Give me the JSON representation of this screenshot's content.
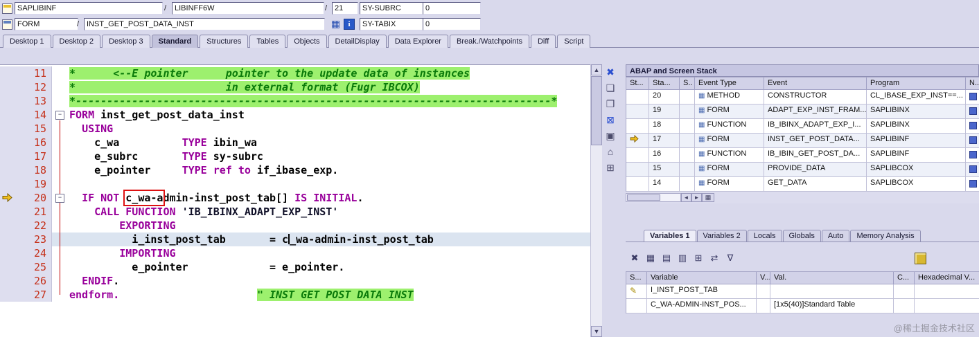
{
  "header": {
    "separator": "/",
    "program_field": "SAPLIBINF",
    "include_field": "LIBINFF6W",
    "line_field": "21",
    "sy_subrc_label": "SY-SUBRC",
    "sy_subrc_value": "0",
    "event_type_field": "FORM",
    "event_name_field": "INST_GET_POST_DATA_INST",
    "sy_tabix_label": "SY-TABIX",
    "sy_tabix_value": "0"
  },
  "tabs": [
    {
      "label": "Desktop 1",
      "active": false
    },
    {
      "label": "Desktop 2",
      "active": false
    },
    {
      "label": "Desktop 3",
      "active": false
    },
    {
      "label": "Standard",
      "active": true
    },
    {
      "label": "Structures",
      "active": false
    },
    {
      "label": "Tables",
      "active": false
    },
    {
      "label": "Objects",
      "active": false
    },
    {
      "label": "DetailDisplay",
      "active": false
    },
    {
      "label": "Data Explorer",
      "active": false
    },
    {
      "label": "Break./Watchpoints",
      "active": false
    },
    {
      "label": "Diff",
      "active": false
    },
    {
      "label": "Script",
      "active": false
    }
  ],
  "editor": {
    "lines": [
      {
        "num": "11",
        "segs": [
          {
            "t": "*      <--E pointer      pointer to the update data of instances",
            "c": "cmt"
          }
        ]
      },
      {
        "num": "12",
        "segs": [
          {
            "t": "*                        in external format (Fugr IBCOX)",
            "c": "cmt"
          }
        ]
      },
      {
        "num": "13",
        "segs": [
          {
            "t": "*----------------------------------------------------------------------------*",
            "c": "cmt"
          }
        ]
      },
      {
        "num": "14",
        "fold": true,
        "segs": [
          {
            "t": "FORM",
            "c": "kw"
          },
          {
            "t": " inst_get_post_data_inst",
            "c": "id"
          }
        ]
      },
      {
        "num": "15",
        "segs": [
          {
            "t": "  ",
            "c": "id"
          },
          {
            "t": "USING",
            "c": "kw"
          }
        ]
      },
      {
        "num": "16",
        "segs": [
          {
            "t": "    c_wa          ",
            "c": "id"
          },
          {
            "t": "TYPE",
            "c": "kw"
          },
          {
            "t": " ibin_wa",
            "c": "id"
          }
        ]
      },
      {
        "num": "17",
        "segs": [
          {
            "t": "    e_subrc       ",
            "c": "id"
          },
          {
            "t": "TYPE",
            "c": "kw"
          },
          {
            "t": " sy-subrc",
            "c": "id"
          }
        ]
      },
      {
        "num": "18",
        "segs": [
          {
            "t": "    e_pointer     ",
            "c": "id"
          },
          {
            "t": "TYPE ref to",
            "c": "kw"
          },
          {
            "t": " if_ibase_exp.",
            "c": "id"
          }
        ]
      },
      {
        "num": "19",
        "segs": []
      },
      {
        "num": "20",
        "fold": true,
        "arrow": true,
        "segs": [
          {
            "t": "  ",
            "c": "id"
          },
          {
            "t": "IF NOT",
            "c": "kw"
          },
          {
            "t": " ",
            "c": "id"
          },
          {
            "t": "c_wa-a",
            "c": "id",
            "box": true
          },
          {
            "t": "dmin-inst_post_tab[] ",
            "c": "id"
          },
          {
            "t": "IS INITIAL",
            "c": "kw"
          },
          {
            "t": ".",
            "c": "id"
          }
        ]
      },
      {
        "num": "21",
        "segs": [
          {
            "t": "    ",
            "c": "id"
          },
          {
            "t": "CALL FUNCTION",
            "c": "kw"
          },
          {
            "t": " ",
            "c": "id"
          },
          {
            "t": "'IB_IBINX_ADAPT_EXP_INST'",
            "c": "str"
          }
        ]
      },
      {
        "num": "22",
        "segs": [
          {
            "t": "        ",
            "c": "id"
          },
          {
            "t": "EXPORTING",
            "c": "kw"
          }
        ]
      },
      {
        "num": "23",
        "hl": true,
        "segs": [
          {
            "t": "          i_inst_post_tab       = c",
            "c": "id"
          },
          {
            "cursor": true
          },
          {
            "t": "_wa-admin-inst_post_tab",
            "c": "id"
          }
        ]
      },
      {
        "num": "24",
        "segs": [
          {
            "t": "        ",
            "c": "id"
          },
          {
            "t": "IMPORTING",
            "c": "kw"
          }
        ]
      },
      {
        "num": "25",
        "segs": [
          {
            "t": "          e_pointer             = e_pointer.",
            "c": "id"
          }
        ]
      },
      {
        "num": "26",
        "segs": [
          {
            "t": "  ",
            "c": "id"
          },
          {
            "t": "ENDIF",
            "c": "kw"
          },
          {
            "t": ".",
            "c": "id"
          }
        ]
      },
      {
        "num": "27",
        "segs": [
          {
            "t": "endform.",
            "c": "kw"
          },
          {
            "t": "                      ",
            "c": "id"
          },
          {
            "t": "\" INST GET POST DATA INST",
            "c": "cmt"
          }
        ]
      }
    ]
  },
  "side_toolbar": {
    "icons": [
      {
        "name": "close-icon",
        "glyph": "✖",
        "color": "#2b4fd0"
      },
      {
        "name": "new-page-icon",
        "glyph": "❏",
        "color": "#4a4a6a"
      },
      {
        "name": "copy-page-icon",
        "glyph": "❐",
        "color": "#4a4a6a"
      },
      {
        "name": "close-window-icon",
        "glyph": "⊠",
        "color": "#2b4fd0"
      },
      {
        "name": "window-icon",
        "glyph": "▣",
        "color": "#4a4a6a"
      },
      {
        "name": "home-icon",
        "glyph": "⌂",
        "color": "#4a4a6a"
      },
      {
        "name": "structure-icon",
        "glyph": "⊞",
        "color": "#4a4a6a"
      }
    ]
  },
  "stack_panel": {
    "title": "ABAP and Screen Stack",
    "columns": [
      "St...",
      "Sta...",
      "S..",
      "Event Type",
      "Event",
      "Program",
      "N..."
    ],
    "rows": [
      {
        "arrow": false,
        "level": "20",
        "event_type": "METHOD",
        "event": "CONSTRUCTOR",
        "program": "CL_IBASE_EXP_INST==..."
      },
      {
        "arrow": false,
        "level": "19",
        "event_type": "FORM",
        "event": "ADAPT_EXP_INST_FRAM...",
        "program": "SAPLIBINX"
      },
      {
        "arrow": false,
        "level": "18",
        "event_type": "FUNCTION",
        "event": "IB_IBINX_ADAPT_EXP_I...",
        "program": "SAPLIBINX"
      },
      {
        "arrow": true,
        "level": "17",
        "event_type": "FORM",
        "event": "INST_GET_POST_DATA...",
        "program": "SAPLIBINF"
      },
      {
        "arrow": false,
        "level": "16",
        "event_type": "FUNCTION",
        "event": "IB_IBIN_GET_POST_DA...",
        "program": "SAPLIBINF"
      },
      {
        "arrow": false,
        "level": "15",
        "event_type": "FORM",
        "event": "PROVIDE_DATA",
        "program": "SAPLIBCOX"
      },
      {
        "arrow": false,
        "level": "14",
        "event_type": "FORM",
        "event": "GET_DATA",
        "program": "SAPLIBCOX"
      }
    ]
  },
  "variables_panel": {
    "tabs": [
      {
        "label": "Variables 1",
        "active": true
      },
      {
        "label": "Variables 2",
        "active": false
      },
      {
        "label": "Locals",
        "active": false
      },
      {
        "label": "Globals",
        "active": false
      },
      {
        "label": "Auto",
        "active": false
      },
      {
        "label": "Memory Analysis",
        "active": false
      }
    ],
    "toolbar_icons": [
      {
        "name": "delete-icon",
        "glyph": "✖"
      },
      {
        "name": "layout-icon",
        "glyph": "▦"
      },
      {
        "name": "table-view-icon",
        "glyph": "▤"
      },
      {
        "name": "export-icon",
        "glyph": "▥"
      },
      {
        "name": "insert-column-icon",
        "glyph": "⊞"
      },
      {
        "name": "swap-icon",
        "glyph": "⇄"
      },
      {
        "name": "filter-icon",
        "glyph": "∇"
      }
    ],
    "columns": [
      "S...",
      "Variable",
      "V...",
      "Val.",
      "C...",
      "Hexadecimal V..."
    ],
    "rows": [
      {
        "icon": "pencil",
        "variable": "I_INST_POST_TAB",
        "val": ""
      },
      {
        "icon": "",
        "variable": "C_WA-ADMIN-INST_POS...",
        "val": "[1x5(40)]Standard Table"
      }
    ]
  },
  "watermark": "@稀土掘金技术社区"
}
